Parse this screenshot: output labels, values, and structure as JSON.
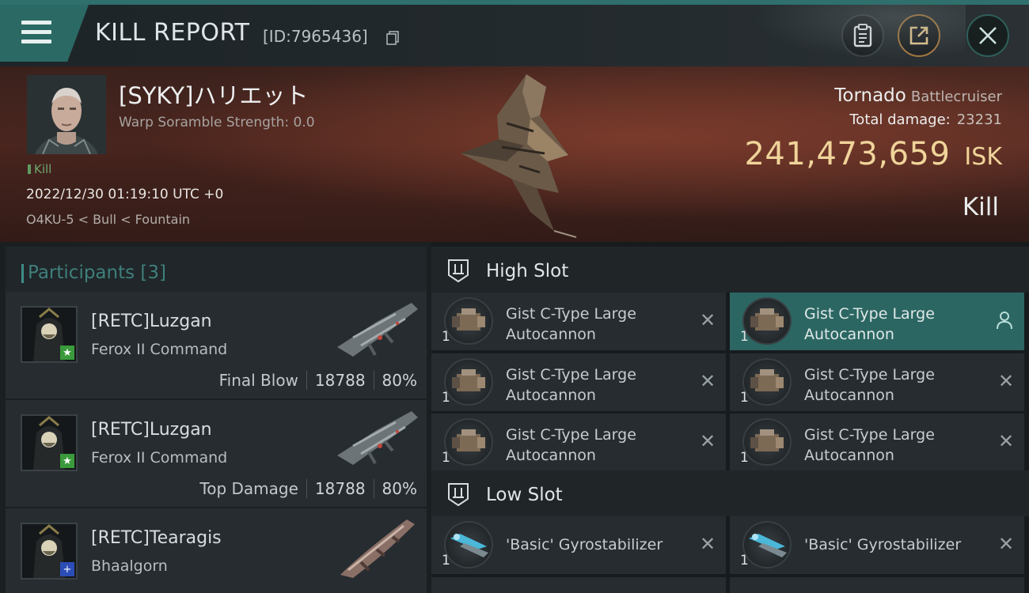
{
  "header": {
    "title": "KILL REPORT",
    "report_id": "[ID:7965436]"
  },
  "victim": {
    "name": "[SYKY]ハリエット",
    "scramble": "Warp Soramble Strength: 0.0",
    "kill_tag": "Kill",
    "datetime": "2022/12/30 01:19:10 UTC +0",
    "location": "O4KU-5 < Bull < Fountain",
    "ship": "Tornado",
    "ship_class": "Battlecruiser",
    "total_damage_label": "Total damage:",
    "total_damage": "23231",
    "isk_value": "241,473,659",
    "isk_label": "ISK",
    "result": "Kill"
  },
  "participants": {
    "title": "Participants",
    "count": "[3]",
    "rows": [
      {
        "name": "[RETC]Luzgan",
        "ship": "Ferox II Command",
        "label": "Final Blow",
        "damage": "18788",
        "percent": "80%",
        "badge": "★"
      },
      {
        "name": "[RETC]Luzgan",
        "ship": "Ferox II Command",
        "label": "Top Damage",
        "damage": "18788",
        "percent": "80%",
        "badge": "★"
      },
      {
        "name": "[RETC]Tearagis",
        "ship": "Bhaalgorn",
        "label": "",
        "damage": "",
        "percent": "",
        "badge": "+"
      }
    ]
  },
  "slots": {
    "high": {
      "title": "High Slot",
      "modules": [
        {
          "line1": "Gist C-Type Large",
          "line2": "Autocannon",
          "qty": "1"
        },
        {
          "line1": "Gist C-Type Large",
          "line2": "Autocannon",
          "qty": "1"
        },
        {
          "line1": "Gist C-Type Large",
          "line2": "Autocannon",
          "qty": "1"
        },
        {
          "line1": "Gist C-Type Large",
          "line2": "Autocannon",
          "qty": "1"
        },
        {
          "line1": "Gist C-Type Large",
          "line2": "Autocannon",
          "qty": "1"
        },
        {
          "line1": "Gist C-Type Large",
          "line2": "Autocannon",
          "qty": "1"
        }
      ]
    },
    "low": {
      "title": "Low Slot",
      "modules": [
        {
          "line1": "'Basic' Gyrostabilizer",
          "qty": "1"
        },
        {
          "line1": "'Basic' Gyrostabilizer",
          "qty": "1"
        }
      ]
    }
  },
  "colors": {
    "accent_teal": "#2b6964",
    "isk_gold": "#f0d49a",
    "badge_green": "#3b9a3c",
    "badge_blue": "#2c4db8"
  }
}
